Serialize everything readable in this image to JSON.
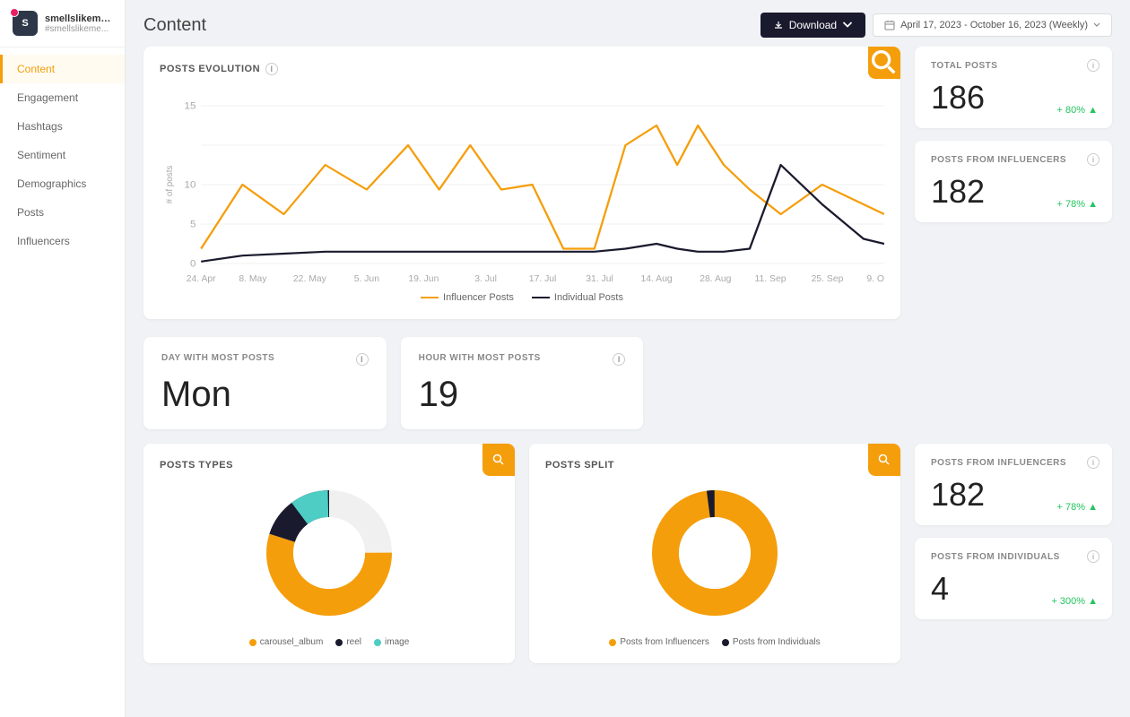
{
  "app": {
    "username": "smellslikeme...",
    "handle": "#smellslikeme...",
    "avatar_initials": "S"
  },
  "nav": {
    "items": [
      {
        "label": "Content",
        "active": true
      },
      {
        "label": "Engagement",
        "active": false
      },
      {
        "label": "Hashtags",
        "active": false
      },
      {
        "label": "Sentiment",
        "active": false
      },
      {
        "label": "Demographics",
        "active": false
      },
      {
        "label": "Posts",
        "active": false
      },
      {
        "label": "Influencers",
        "active": false
      }
    ]
  },
  "header": {
    "page_title": "Content",
    "download_label": "Download",
    "date_range": "April 17, 2023 - October 16, 2023 (Weekly)"
  },
  "posts_evolution": {
    "title": "POSTS EVOLUTION",
    "legend": {
      "influencer_posts": "Influencer Posts",
      "individual_posts": "Individual Posts"
    },
    "x_labels": [
      "24. Apr",
      "8. May",
      "22. May",
      "5. Jun",
      "19. Jun",
      "3. Jul",
      "17. Jul",
      "31. Jul",
      "14. Aug",
      "28. Aug",
      "11. Sep",
      "25. Sep",
      "9. Oct"
    ]
  },
  "total_posts": {
    "label": "TOTAL POSTS",
    "value": "186",
    "change": "+ 80% ▲"
  },
  "posts_from_influencers_top": {
    "label": "POSTS FROM INFLUENCERS",
    "value": "182",
    "change": "+ 78% ▲"
  },
  "day_with_most_posts": {
    "label": "DAY WITH MOST POSTS",
    "value": "Mon"
  },
  "hour_with_most_posts": {
    "label": "HOUR WITH MOST POSTS",
    "value": "19"
  },
  "posts_types": {
    "title": "POSTS TYPES",
    "legend": [
      {
        "color": "#f59e0b",
        "label": "carousel_album"
      },
      {
        "color": "#1a1a2e",
        "label": "reel"
      },
      {
        "color": "#4ecdc4",
        "label": "image"
      }
    ]
  },
  "posts_split": {
    "title": "POSTS SPLIT",
    "legend": [
      {
        "color": "#f59e0b",
        "label": "Posts from Influencers"
      },
      {
        "color": "#1a1a2e",
        "label": "Posts from Individuals"
      }
    ]
  },
  "posts_from_influencers_bottom": {
    "label": "POSTS FROM INFLUENCERS",
    "value": "182",
    "change": "+ 78% ▲"
  },
  "posts_from_individuals": {
    "label": "POSTS FROM INDIVIDUALS",
    "value": "4",
    "change": "+ 300% ▲"
  }
}
